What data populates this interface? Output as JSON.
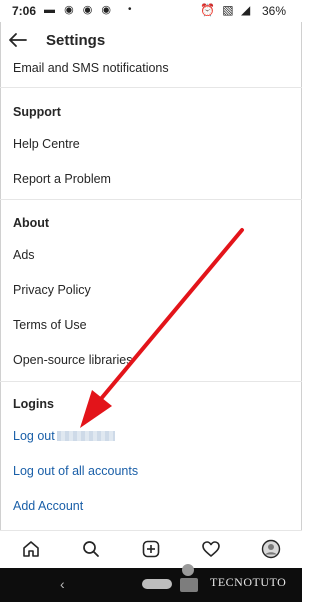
{
  "status_bar": {
    "time": "7:06",
    "left_icons": [
      "notification-icon",
      "chrome-icon",
      "chrome-icon",
      "chrome-icon"
    ],
    "right_icons": [
      "alarm-icon",
      "no-sim-icon",
      "signal-icon"
    ],
    "battery": "36%"
  },
  "header": {
    "title": "Settings"
  },
  "items": {
    "email_sms": "Email and SMS notifications",
    "support_heading": "Support",
    "help_centre": "Help Centre",
    "report_problem": "Report a Problem",
    "about_heading": "About",
    "ads": "Ads",
    "privacy": "Privacy Policy",
    "terms": "Terms of Use",
    "open_source": "Open-source libraries",
    "logins_heading": "Logins",
    "log_out": "Log out",
    "log_out_all": "Log out of all accounts",
    "add_account": "Add Account"
  },
  "colors": {
    "link": "#1a5fa8",
    "annotation_arrow": "#e3141a"
  },
  "watermark": {
    "text": "TECNOTUTO"
  },
  "bottom_nav": [
    "home-icon",
    "search-icon",
    "new-post-icon",
    "activity-heart-icon",
    "profile-avatar-icon"
  ]
}
